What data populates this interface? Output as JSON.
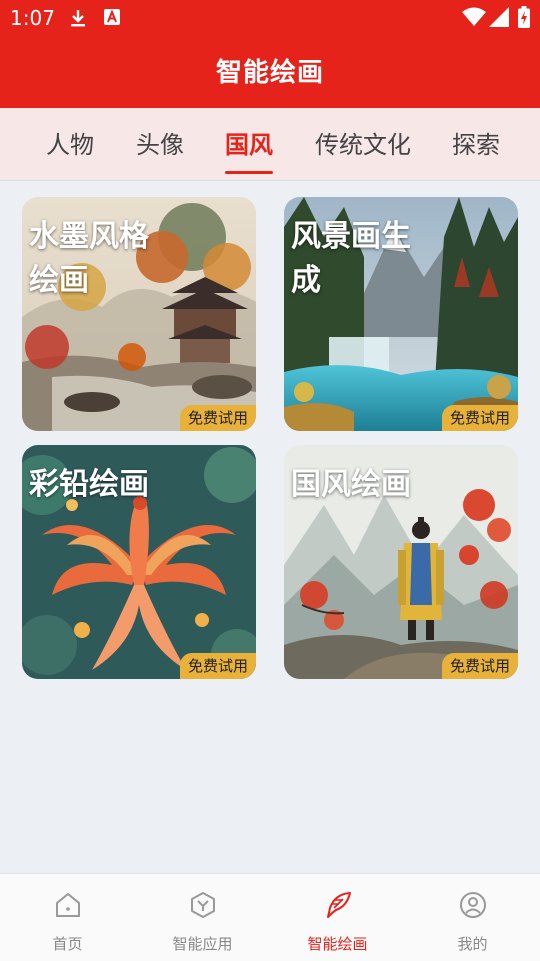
{
  "status_bar": {
    "time": "1:07",
    "icons": [
      "download-icon",
      "app-notification-icon",
      "wifi-icon",
      "signal-icon",
      "battery-charging-icon"
    ]
  },
  "app_bar": {
    "title": "智能绘画"
  },
  "tabs": [
    {
      "label": "人物"
    },
    {
      "label": "头像"
    },
    {
      "label": "国风",
      "active": true
    },
    {
      "label": "传统文化"
    },
    {
      "label": "探索"
    }
  ],
  "cards": [
    {
      "title": "水墨风格绘画",
      "badge": "免费试用"
    },
    {
      "title": "风景画生成",
      "badge": "免费试用"
    },
    {
      "title": "彩铅绘画",
      "badge": "免费试用"
    },
    {
      "title": "国风绘画",
      "badge": "免费试用"
    }
  ],
  "bottom_nav": [
    {
      "label": "首页",
      "icon": "home-icon"
    },
    {
      "label": "智能应用",
      "icon": "hexagon-y-icon"
    },
    {
      "label": "智能绘画",
      "icon": "feather-pen-icon",
      "active": true
    },
    {
      "label": "我的",
      "icon": "user-circle-icon"
    }
  ],
  "colors": {
    "primary": "#e5231b",
    "tab_background": "#f8e7e7",
    "page_background": "#eceff3",
    "badge": "#e8b13a"
  }
}
